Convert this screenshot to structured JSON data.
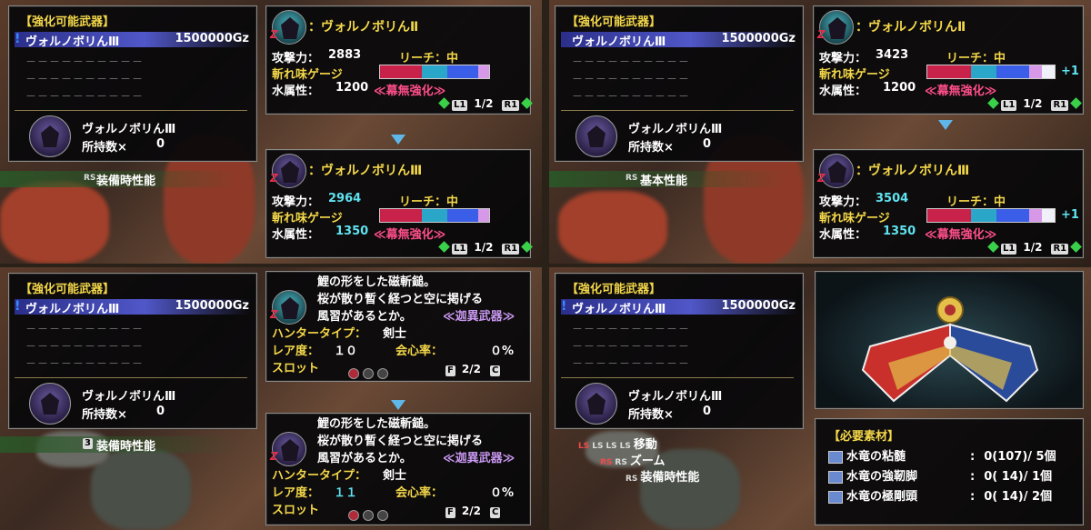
{
  "upgrade_list": {
    "title": "【強化可能武器】",
    "selected": "ヴォルノボリんⅢ",
    "price": "1500000Gz",
    "dashes": "－－－－－－－－－－"
  },
  "owned": {
    "name": "ヴォルノボリんⅢ",
    "count_label": "所持数×",
    "count": "0"
  },
  "strips": {
    "equip_perf": "装備時性能",
    "base_perf": "基本性能",
    "rs": "RS",
    "btn3": "3"
  },
  "stats_labels": {
    "attack": "攻撃力：",
    "reach": "リーチ：中",
    "sharpness": "斬れ味ゲージ",
    "element": "水属性：",
    "nullify": "≪幕無強化≫",
    "plus1": "+1"
  },
  "q1": {
    "top": {
      "name": "：ヴォルノボリんⅡ",
      "attack": "2883",
      "element": "1200"
    },
    "bottom": {
      "name": "：ヴォルノボリんⅢ",
      "attack": "2964",
      "element": "1350"
    },
    "page": "1/2"
  },
  "q2": {
    "top": {
      "name": "：ヴォルノボリんⅡ",
      "attack": "3423",
      "element": "1200"
    },
    "bottom": {
      "name": "：ヴォルノボリんⅢ",
      "attack": "3504",
      "element": "1350"
    },
    "page": "1/2"
  },
  "desc": {
    "line1": "鯉の形をした磁斬鎚。",
    "line2": "桜が散り暫く経つと空に掲げる",
    "line3": "風習があるとか。",
    "rarity_tag": "≪迦異武器≫",
    "hunter_type_label": "ハンタータイプ：",
    "hunter_type": "剣士",
    "rare_label": "レア度：",
    "rare_top": "１０",
    "rare_bottom": "１１",
    "crit_label": "会心率：",
    "crit": "０%",
    "slot_label": "スロット",
    "slot_page": "2/2"
  },
  "controls": {
    "move": "移動",
    "zoom": "ズーム",
    "ls": "LS",
    "rs": "RS",
    "l1": "L1",
    "r1": "R1",
    "f": "F",
    "cbtn": "C"
  },
  "materials": {
    "title": "【必要素材】",
    "items": [
      {
        "name": "水竜の粘髄",
        "qty": "0(107)/ 5個"
      },
      {
        "name": "水竜の強靭脚",
        "qty": "0( 14)/ 1個"
      },
      {
        "name": "水竜の極剛頭",
        "qty": "0( 14)/ 2個"
      }
    ]
  },
  "colors": {
    "accent_yellow": "#f4d84a",
    "accent_cyan": "#5fe3f0",
    "nullify_pink": "#ff4f8a",
    "sel_blue": "#4b52c4"
  }
}
